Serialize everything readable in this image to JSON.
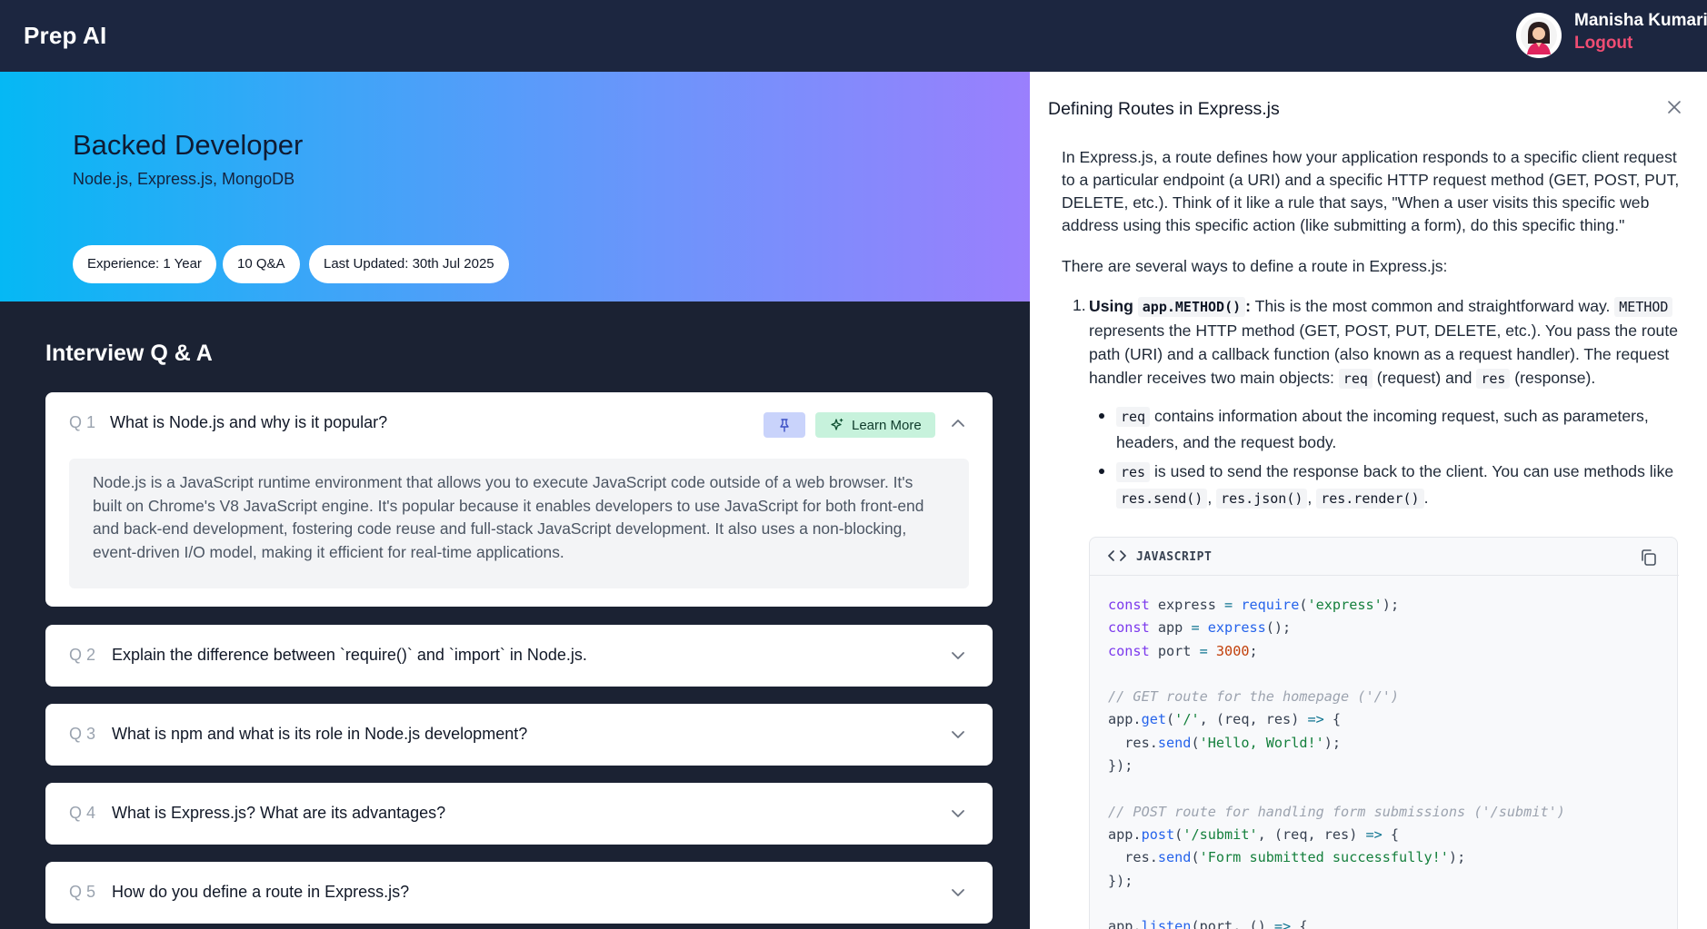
{
  "app": {
    "brand": "Prep AI"
  },
  "user": {
    "name": "Manisha Kumari",
    "logout_label": "Logout"
  },
  "hero": {
    "title": "Backed Developer",
    "topics": "Node.js, Express.js, MongoDB",
    "pills": {
      "experience": "Experience: 1 Year",
      "qa_count": "10 Q&A",
      "updated": "Last Updated: 30th Jul 2025"
    }
  },
  "qa_section": {
    "title": "Interview Q & A",
    "learn_more_label": "Learn More",
    "questions": [
      {
        "num": "Q 1",
        "text": "What is Node.js and why is it popular?",
        "expanded": true,
        "answer": "Node.js is a JavaScript runtime environment that allows you to execute JavaScript code outside of a web browser. It's built on Chrome's V8 JavaScript engine. It's popular because it enables developers to use JavaScript for both front-end and back-end development, fostering code reuse and full-stack JavaScript development. It also uses a non-blocking, event-driven I/O model, making it efficient for real-time applications."
      },
      {
        "num": "Q 2",
        "text": "Explain the difference between `require()` and `import` in Node.js."
      },
      {
        "num": "Q 3",
        "text": "What is npm and what is its role in Node.js development?"
      },
      {
        "num": "Q 4",
        "text": "What is Express.js? What are its advantages?"
      },
      {
        "num": "Q 5",
        "text": "How do you define a route in Express.js?"
      }
    ]
  },
  "panel": {
    "title": "Defining Routes in Express.js",
    "intro": "In Express.js, a route defines how your application responds to a specific client request to a particular endpoint (a URI) and a specific HTTP request method (GET, POST, PUT, DELETE, etc.). Think of it like a rule that says, \"When a user visits this specific web address using this specific action (like submitting a form), do this specific thing.\"",
    "ways": "There are several ways to define a route in Express.js:",
    "item1": {
      "marker": "1.",
      "lead": "Using",
      "lead_code": "app.METHOD()",
      "lead_colon": ":",
      "t1": " This is the most common and straightforward way.",
      "code_method": "METHOD",
      "t2": " represents the HTTP method (GET, POST, PUT, DELETE, etc.). You pass the route path (URI) and a callback function (also known as a request handler). The request handler receives two main objects: ",
      "code_req": "req",
      "t3": " (request) and ",
      "code_res": "res",
      "t4": " (response)."
    },
    "bullets": {
      "req_code": "req",
      "req_text": " contains information about the incoming request, such as parameters, headers, and the request body.",
      "res_code": "res",
      "res_text": " is used to send the response back to the client. You can use methods like ",
      "m1": "res.send()",
      "sep1": ", ",
      "m2": "res.json()",
      "sep2": ", ",
      "m3": "res.render()",
      "end": "."
    },
    "code_block": {
      "language": "JAVASCRIPT",
      "lines": [
        "const express = require('express');",
        "const app = express();",
        "const port = 3000;",
        "",
        "// GET route for the homepage ('/')",
        "app.get('/', (req, res) => {",
        "  res.send('Hello, World!');",
        "});",
        "",
        "// POST route for handling form submissions ('/submit')",
        "app.post('/submit', (req, res) => {",
        "  res.send('Form submitted successfully!');",
        "});",
        "",
        "app.listen(port, () => {"
      ]
    }
  },
  "colors": {
    "topbar": "#1c2640",
    "logout": "#ef4d73",
    "hero_start": "#05b8f4",
    "hero_end": "#9a7ffd",
    "dark_bg": "#1b2233",
    "pin_bg": "#c9d3fb",
    "learn_bg": "#c7f2dc"
  },
  "icons": {
    "avatar": "avatar-woman",
    "pin": "pin-icon",
    "learn": "sparkle-icon",
    "chevron": "chevron-icon",
    "close": "close-icon",
    "copy": "copy-icon",
    "code": "code-brackets-icon"
  }
}
